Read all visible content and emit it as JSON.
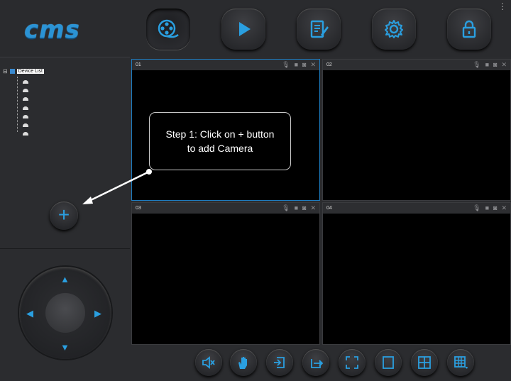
{
  "app": {
    "logo_text": "cms"
  },
  "nav": [
    {
      "name": "live-view",
      "icon": "film-reel-icon",
      "active": true
    },
    {
      "name": "playback",
      "icon": "play-icon"
    },
    {
      "name": "log",
      "icon": "edit-doc-icon"
    },
    {
      "name": "settings",
      "icon": "gear-icon"
    },
    {
      "name": "lock",
      "icon": "lock-icon"
    }
  ],
  "device_tree": {
    "root_label": "Device List"
  },
  "panes": [
    {
      "id": "01"
    },
    {
      "id": "02"
    },
    {
      "id": "03"
    },
    {
      "id": "04"
    }
  ],
  "callout": {
    "line1": "Step 1: Click on + button",
    "line2": "to add Camera"
  },
  "add_button": {
    "label": "+"
  },
  "ptz": {
    "up": "▲",
    "down": "▼",
    "left": "◀",
    "right": "▶"
  },
  "colors": {
    "accent": "#2a9fe0",
    "background": "#2b2c2f",
    "pane_selected": "#1e7cc0"
  }
}
